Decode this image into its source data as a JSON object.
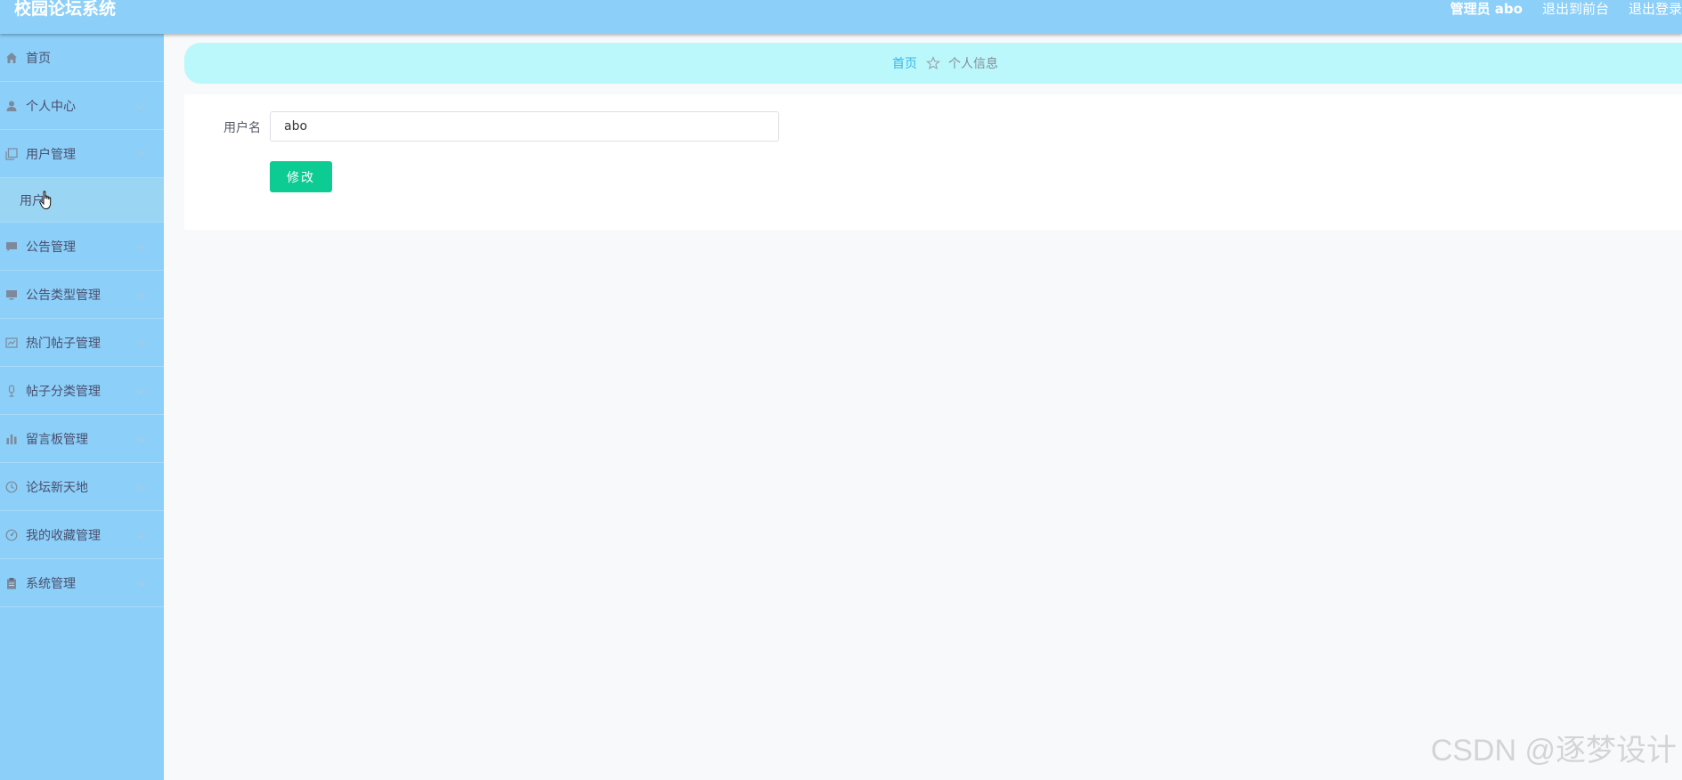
{
  "header": {
    "title": "校园论坛系统",
    "admin_label": "管理员 abo",
    "exit_front_label": "退出到前台",
    "logout_label": "退出登录"
  },
  "sidebar": {
    "items": [
      {
        "label": "首页",
        "icon": "home-icon"
      },
      {
        "label": "个人中心",
        "icon": "user-icon"
      },
      {
        "label": "用户管理",
        "icon": "copy-icon",
        "expanded": true
      },
      {
        "label": "公告管理",
        "icon": "message-icon"
      },
      {
        "label": "公告类型管理",
        "icon": "monitor-icon"
      },
      {
        "label": "热门帖子管理",
        "icon": "chart-box-icon"
      },
      {
        "label": "帖子分类管理",
        "icon": "microphone-icon"
      },
      {
        "label": "留言板管理",
        "icon": "bar-chart-icon"
      },
      {
        "label": "论坛新天地",
        "icon": "clock-icon"
      },
      {
        "label": "我的收藏管理",
        "icon": "dashboard-icon"
      },
      {
        "label": "系统管理",
        "icon": "clipboard-icon"
      }
    ],
    "submenu": {
      "label": "用户"
    }
  },
  "breadcrumb": {
    "home": "首页",
    "current": "个人信息"
  },
  "form": {
    "username_label": "用户名",
    "username_value": "abo",
    "submit_label": "修改"
  },
  "watermark": "CSDN @逐梦设计",
  "colors": {
    "topbar": "#8ccff8",
    "sidebar": "#8ccff8",
    "breadcrumb_bg": "#bbf8fb",
    "breadcrumb_link": "#3db5e6",
    "primary_button": "#0ccc94"
  }
}
